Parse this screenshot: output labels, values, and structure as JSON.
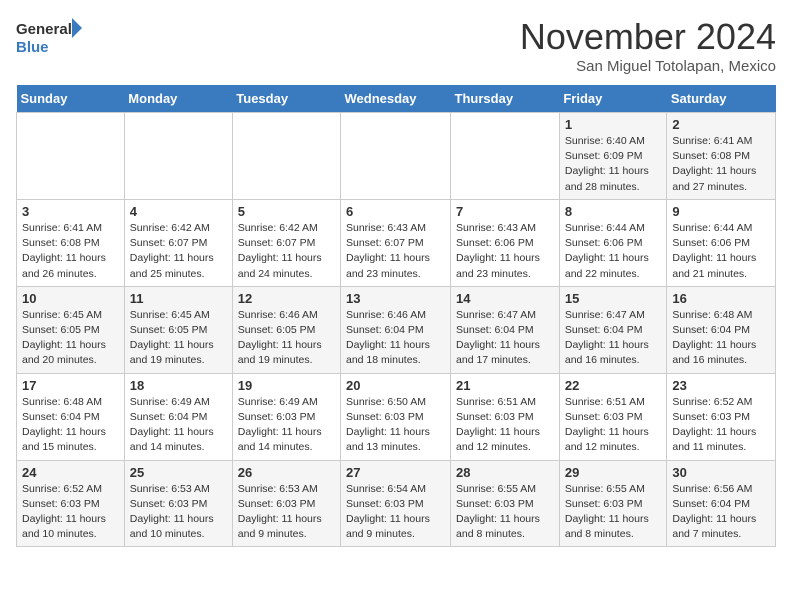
{
  "header": {
    "logo_line1": "General",
    "logo_line2": "Blue",
    "month": "November 2024",
    "location": "San Miguel Totolapan, Mexico"
  },
  "weekdays": [
    "Sunday",
    "Monday",
    "Tuesday",
    "Wednesday",
    "Thursday",
    "Friday",
    "Saturday"
  ],
  "weeks": [
    [
      {
        "day": "",
        "info": ""
      },
      {
        "day": "",
        "info": ""
      },
      {
        "day": "",
        "info": ""
      },
      {
        "day": "",
        "info": ""
      },
      {
        "day": "",
        "info": ""
      },
      {
        "day": "1",
        "info": "Sunrise: 6:40 AM\nSunset: 6:09 PM\nDaylight: 11 hours\nand 28 minutes."
      },
      {
        "day": "2",
        "info": "Sunrise: 6:41 AM\nSunset: 6:08 PM\nDaylight: 11 hours\nand 27 minutes."
      }
    ],
    [
      {
        "day": "3",
        "info": "Sunrise: 6:41 AM\nSunset: 6:08 PM\nDaylight: 11 hours\nand 26 minutes."
      },
      {
        "day": "4",
        "info": "Sunrise: 6:42 AM\nSunset: 6:07 PM\nDaylight: 11 hours\nand 25 minutes."
      },
      {
        "day": "5",
        "info": "Sunrise: 6:42 AM\nSunset: 6:07 PM\nDaylight: 11 hours\nand 24 minutes."
      },
      {
        "day": "6",
        "info": "Sunrise: 6:43 AM\nSunset: 6:07 PM\nDaylight: 11 hours\nand 23 minutes."
      },
      {
        "day": "7",
        "info": "Sunrise: 6:43 AM\nSunset: 6:06 PM\nDaylight: 11 hours\nand 23 minutes."
      },
      {
        "day": "8",
        "info": "Sunrise: 6:44 AM\nSunset: 6:06 PM\nDaylight: 11 hours\nand 22 minutes."
      },
      {
        "day": "9",
        "info": "Sunrise: 6:44 AM\nSunset: 6:06 PM\nDaylight: 11 hours\nand 21 minutes."
      }
    ],
    [
      {
        "day": "10",
        "info": "Sunrise: 6:45 AM\nSunset: 6:05 PM\nDaylight: 11 hours\nand 20 minutes."
      },
      {
        "day": "11",
        "info": "Sunrise: 6:45 AM\nSunset: 6:05 PM\nDaylight: 11 hours\nand 19 minutes."
      },
      {
        "day": "12",
        "info": "Sunrise: 6:46 AM\nSunset: 6:05 PM\nDaylight: 11 hours\nand 19 minutes."
      },
      {
        "day": "13",
        "info": "Sunrise: 6:46 AM\nSunset: 6:04 PM\nDaylight: 11 hours\nand 18 minutes."
      },
      {
        "day": "14",
        "info": "Sunrise: 6:47 AM\nSunset: 6:04 PM\nDaylight: 11 hours\nand 17 minutes."
      },
      {
        "day": "15",
        "info": "Sunrise: 6:47 AM\nSunset: 6:04 PM\nDaylight: 11 hours\nand 16 minutes."
      },
      {
        "day": "16",
        "info": "Sunrise: 6:48 AM\nSunset: 6:04 PM\nDaylight: 11 hours\nand 16 minutes."
      }
    ],
    [
      {
        "day": "17",
        "info": "Sunrise: 6:48 AM\nSunset: 6:04 PM\nDaylight: 11 hours\nand 15 minutes."
      },
      {
        "day": "18",
        "info": "Sunrise: 6:49 AM\nSunset: 6:04 PM\nDaylight: 11 hours\nand 14 minutes."
      },
      {
        "day": "19",
        "info": "Sunrise: 6:49 AM\nSunset: 6:03 PM\nDaylight: 11 hours\nand 14 minutes."
      },
      {
        "day": "20",
        "info": "Sunrise: 6:50 AM\nSunset: 6:03 PM\nDaylight: 11 hours\nand 13 minutes."
      },
      {
        "day": "21",
        "info": "Sunrise: 6:51 AM\nSunset: 6:03 PM\nDaylight: 11 hours\nand 12 minutes."
      },
      {
        "day": "22",
        "info": "Sunrise: 6:51 AM\nSunset: 6:03 PM\nDaylight: 11 hours\nand 12 minutes."
      },
      {
        "day": "23",
        "info": "Sunrise: 6:52 AM\nSunset: 6:03 PM\nDaylight: 11 hours\nand 11 minutes."
      }
    ],
    [
      {
        "day": "24",
        "info": "Sunrise: 6:52 AM\nSunset: 6:03 PM\nDaylight: 11 hours\nand 10 minutes."
      },
      {
        "day": "25",
        "info": "Sunrise: 6:53 AM\nSunset: 6:03 PM\nDaylight: 11 hours\nand 10 minutes."
      },
      {
        "day": "26",
        "info": "Sunrise: 6:53 AM\nSunset: 6:03 PM\nDaylight: 11 hours\nand 9 minutes."
      },
      {
        "day": "27",
        "info": "Sunrise: 6:54 AM\nSunset: 6:03 PM\nDaylight: 11 hours\nand 9 minutes."
      },
      {
        "day": "28",
        "info": "Sunrise: 6:55 AM\nSunset: 6:03 PM\nDaylight: 11 hours\nand 8 minutes."
      },
      {
        "day": "29",
        "info": "Sunrise: 6:55 AM\nSunset: 6:03 PM\nDaylight: 11 hours\nand 8 minutes."
      },
      {
        "day": "30",
        "info": "Sunrise: 6:56 AM\nSunset: 6:04 PM\nDaylight: 11 hours\nand 7 minutes."
      }
    ]
  ]
}
